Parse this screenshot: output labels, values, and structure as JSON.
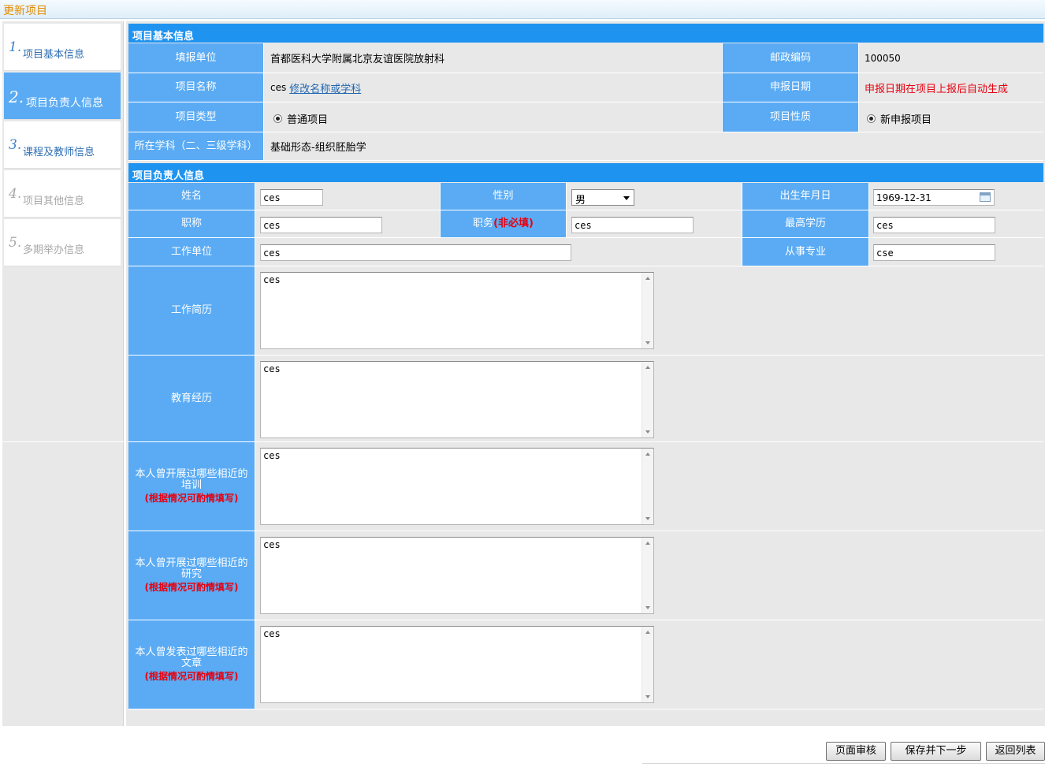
{
  "window": {
    "title": "更新项目"
  },
  "steps": [
    {
      "num": "1.",
      "label": "项目基本信息"
    },
    {
      "num": "2.",
      "label": "项目负责人信息"
    },
    {
      "num": "3.",
      "label": "课程及教师信息"
    },
    {
      "num": "4.",
      "label": "项目其他信息"
    },
    {
      "num": "5.",
      "label": "多期举办信息"
    }
  ],
  "basic": {
    "section_title": "项目基本信息",
    "unit_label": "填报单位",
    "unit_value": "首都医科大学附属北京友谊医院放射科",
    "postcode_label": "邮政编码",
    "postcode_value": "100050",
    "name_label": "项目名称",
    "name_value": "ces",
    "name_link": "修改名称或学科",
    "date_label": "申报日期",
    "date_value": "申报日期在项目上报后自动生成",
    "type_label": "项目类型",
    "type_value": "普通项目",
    "nature_label": "项目性质",
    "nature_value": "新申报项目",
    "subject_label": "所在学科（二、三级学科）",
    "subject_value": "基础形态-组织胚胎学"
  },
  "leader": {
    "section_title": "项目负责人信息",
    "name_label": "姓名",
    "name_value": "ces",
    "gender_label": "性别",
    "gender_value": "男",
    "birth_label": "出生年月日",
    "birth_value": "1969-12-31",
    "title_label": "职称",
    "title_value": "ces",
    "duty_label": "职务",
    "duty_optional": "(非必填)",
    "duty_value": "ces",
    "edu_label": "最高学历",
    "edu_value": "ces",
    "work_unit_label": "工作单位",
    "work_unit_value": "ces",
    "major_label": "从事专业",
    "major_value": "cse",
    "resume_label": "工作简历",
    "resume_value": "ces",
    "education_label": "教育经历",
    "education_value": "ces",
    "training_label": "本人曾开展过哪些相近的培训",
    "training_note": "(根据情况可酌情填写)",
    "training_value": "ces",
    "research_label": "本人曾开展过哪些相近的研究",
    "research_note": "(根据情况可酌情填写)",
    "research_value": "ces",
    "articles_label": "本人曾发表过哪些相近的文章",
    "articles_note": "(根据情况可酌情填写)",
    "articles_value": "ces"
  },
  "buttons": {
    "review": "页面审核",
    "save_next": "保存并下一步",
    "back": "返回列表"
  },
  "colors": {
    "header_blue": "#1f93f0",
    "label_blue": "#5aabf4",
    "title_orange": "#e38b00",
    "required_red": "#e8000f"
  }
}
